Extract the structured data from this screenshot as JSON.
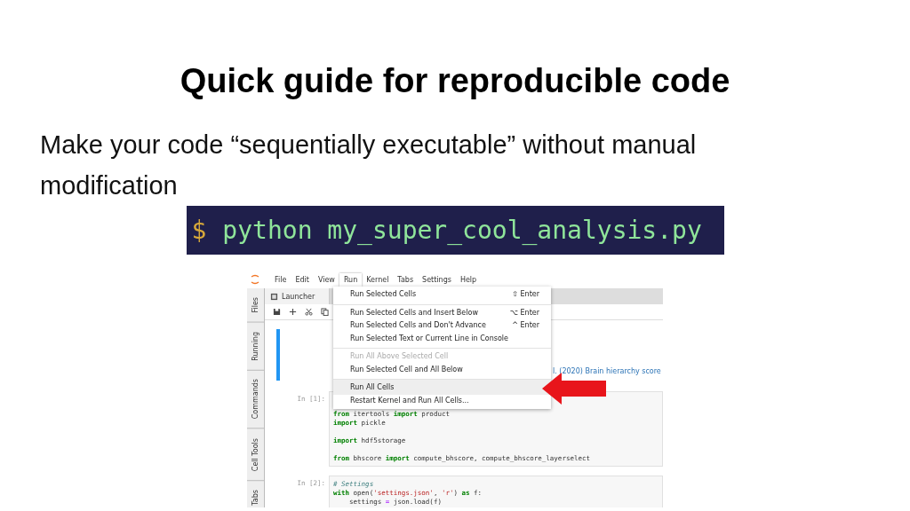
{
  "slide": {
    "title": "Quick guide for reproducible code",
    "subtitle": "Make your code “sequentially executable” without manual modification",
    "command": {
      "prompt": "$",
      "text": "python my_super_cool_analysis.py"
    }
  },
  "jupyter": {
    "sidebar_tabs": [
      "Files",
      "Running",
      "Commands",
      "Cell Tools",
      "Tabs"
    ],
    "menu_bar": [
      {
        "label": "File",
        "selected": false
      },
      {
        "label": "Edit",
        "selected": false
      },
      {
        "label": "View",
        "selected": false
      },
      {
        "label": "Run",
        "selected": true
      },
      {
        "label": "Kernel",
        "selected": false
      },
      {
        "label": "Tabs",
        "selected": false
      },
      {
        "label": "Settings",
        "selected": false
      },
      {
        "label": "Help",
        "selected": false
      }
    ],
    "tab": {
      "label": "Launcher"
    },
    "run_menu": [
      {
        "label": "Run Selected Cells",
        "shortcut": "⇧ Enter",
        "disabled": false,
        "highlighted": false,
        "divider_before": false
      },
      {
        "label": "Run Selected Cells and Insert Below",
        "shortcut": "⌥ Enter",
        "disabled": false,
        "highlighted": false,
        "divider_before": true
      },
      {
        "label": "Run Selected Cells and Don't Advance",
        "shortcut": "^ Enter",
        "disabled": false,
        "highlighted": false,
        "divider_before": false
      },
      {
        "label": "Run Selected Text or Current Line in Console",
        "disabled": false,
        "highlighted": false,
        "divider_before": false
      },
      {
        "label": "Run All Above Selected Cell",
        "disabled": true,
        "highlighted": false,
        "divider_before": true
      },
      {
        "label": "Run Selected Cell and All Below",
        "disabled": false,
        "highlighted": false,
        "divider_before": false
      },
      {
        "label": "Run All Cells",
        "disabled": false,
        "highlighted": true,
        "divider_before": true
      },
      {
        "label": "Restart Kernel and Run All Cells...",
        "disabled": false,
        "highlighted": false,
        "divider_before": false
      }
    ],
    "markdown_cell": {
      "link": "l. (2020) Brain hierarchy score"
    },
    "code_cells": [
      {
        "prompt": "In [1]:",
        "lines": [
          {
            "blank_before": false,
            "tokens": [
              {
                "kind": "kw",
                "text": "from"
              },
              {
                "kind": "plain",
                "text": " itertools "
              },
              {
                "kind": "kw",
                "text": "import"
              },
              {
                "kind": "plain",
                "text": " product"
              }
            ]
          },
          {
            "blank_before": false,
            "tokens": [
              {
                "kind": "kw",
                "text": "import"
              },
              {
                "kind": "plain",
                "text": " pickle"
              }
            ]
          },
          {
            "blank_before": true,
            "tokens": [
              {
                "kind": "kw",
                "text": "import"
              },
              {
                "kind": "plain",
                "text": " hdf5storage"
              }
            ]
          },
          {
            "blank_before": true,
            "tokens": [
              {
                "kind": "kw",
                "text": "from"
              },
              {
                "kind": "plain",
                "text": " bhscore "
              },
              {
                "kind": "kw",
                "text": "import"
              },
              {
                "kind": "plain",
                "text": " compute_bhscore, compute_bhscore_layerselect"
              }
            ]
          }
        ]
      },
      {
        "prompt": "In [2]:",
        "lines": [
          {
            "blank_before": false,
            "tokens": [
              {
                "kind": "comment",
                "text": "# Settings"
              }
            ]
          },
          {
            "blank_before": false,
            "tokens": [
              {
                "kind": "kw",
                "text": "with"
              },
              {
                "kind": "plain",
                "text": " open("
              },
              {
                "kind": "str",
                "text": "'settings.json'"
              },
              {
                "kind": "plain",
                "text": ", "
              },
              {
                "kind": "str",
                "text": "'r'"
              },
              {
                "kind": "plain",
                "text": ") "
              },
              {
                "kind": "kw",
                "text": "as"
              },
              {
                "kind": "plain",
                "text": " f:"
              }
            ]
          },
          {
            "blank_before": false,
            "tokens": [
              {
                "kind": "plain",
                "text": "    settings "
              },
              {
                "kind": "op",
                "text": "="
              },
              {
                "kind": "plain",
                "text": " json.load(f)"
              }
            ]
          }
        ]
      }
    ]
  }
}
